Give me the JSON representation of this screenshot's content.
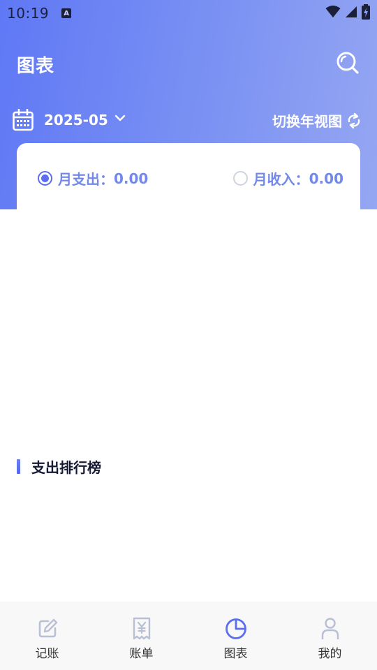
{
  "status_bar": {
    "time": "10:19",
    "notification_icon": "a-letter-icon"
  },
  "header": {
    "title": "图表",
    "search_icon": "search-icon"
  },
  "date_selector": {
    "value": "2025-05",
    "year_view_label": "切换年视图"
  },
  "summary": {
    "expense": {
      "label": "月支出：",
      "value": "0.00",
      "selected": true
    },
    "income": {
      "label": "月收入：",
      "value": "0.00",
      "selected": false
    }
  },
  "ranking": {
    "title": "支出排行榜"
  },
  "tab_bar": {
    "items": [
      {
        "label": "记账",
        "icon": "edit-icon",
        "active": false
      },
      {
        "label": "账单",
        "icon": "receipt-icon",
        "active": false
      },
      {
        "label": "图表",
        "icon": "pie-chart-icon",
        "active": true
      },
      {
        "label": "我的",
        "icon": "user-icon",
        "active": false
      }
    ]
  },
  "colors": {
    "header_gradient_start": "#5f78f5",
    "header_gradient_end": "#95a6f2",
    "accent": "#5a6ef0",
    "summary_text": "#7389ea",
    "tab_inactive": "#b9c0d6"
  }
}
